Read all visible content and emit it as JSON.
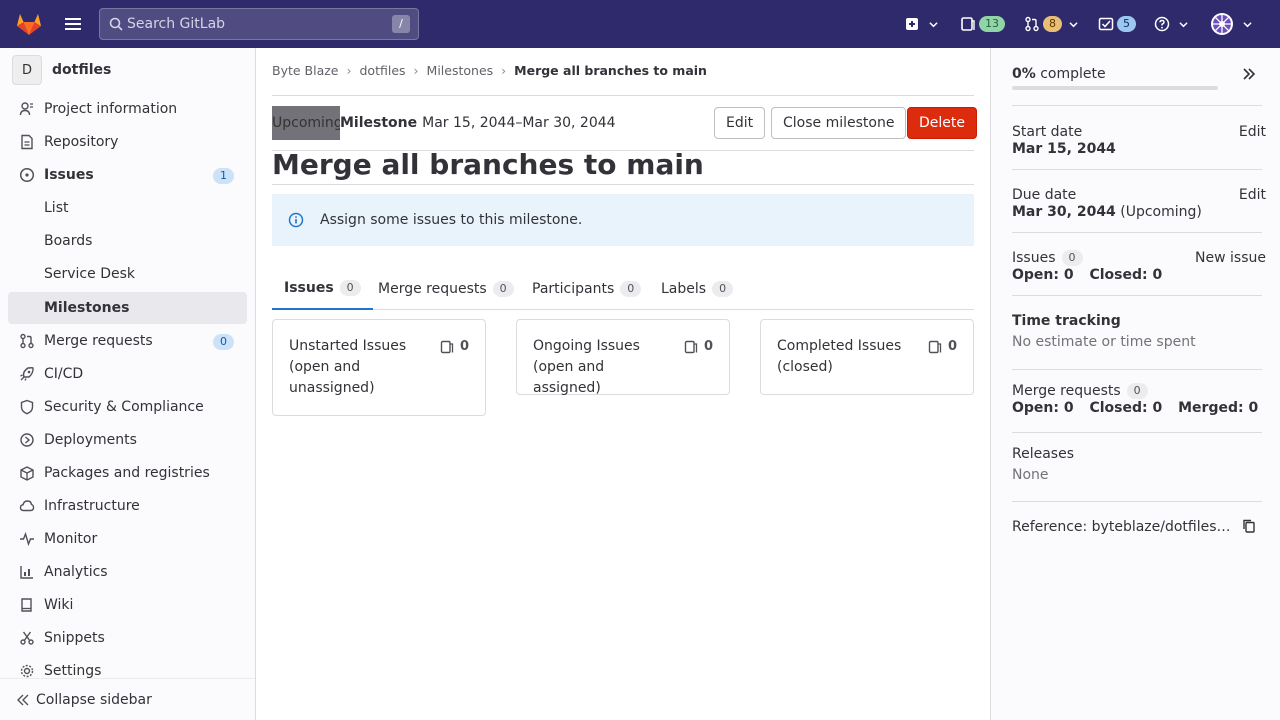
{
  "colors": {
    "topbar": "#2f2a6b",
    "danger": "#dd2b0e",
    "link_accent": "#1f75cb",
    "badge_blue": "#cbe2f9",
    "alert_bg": "#e9f3fc"
  },
  "topbar": {
    "logo_icon": "gitlab-tanuki-icon",
    "menu_icon": "hamburger-icon",
    "search_placeholder": "Search GitLab",
    "search_shortcut": "/",
    "issues_count": "13",
    "merge_requests_count": "8",
    "todos_count": "5"
  },
  "sidebar": {
    "project_initial": "D",
    "project_name": "dotfiles",
    "items": [
      {
        "label": "Project information",
        "icon": "info-icon"
      },
      {
        "label": "Repository",
        "icon": "doc-icon"
      },
      {
        "label": "Issues",
        "icon": "issues-icon",
        "count": "1"
      },
      {
        "label": "List"
      },
      {
        "label": "Boards"
      },
      {
        "label": "Service Desk"
      },
      {
        "label": "Milestones"
      },
      {
        "label": "Merge requests",
        "icon": "merge-request-icon",
        "count": "0"
      },
      {
        "label": "CI/CD",
        "icon": "rocket-icon"
      },
      {
        "label": "Security & Compliance",
        "icon": "shield-icon"
      },
      {
        "label": "Deployments",
        "icon": "deployments-icon"
      },
      {
        "label": "Packages and registries",
        "icon": "package-icon"
      },
      {
        "label": "Infrastructure",
        "icon": "cloud-icon"
      },
      {
        "label": "Monitor",
        "icon": "monitor-icon"
      },
      {
        "label": "Analytics",
        "icon": "chart-icon"
      },
      {
        "label": "Wiki",
        "icon": "book-icon"
      },
      {
        "label": "Snippets",
        "icon": "snippet-icon"
      },
      {
        "label": "Settings",
        "icon": "gear-icon"
      }
    ],
    "collapse_label": "Collapse sidebar"
  },
  "breadcrumb": [
    "Byte Blaze",
    "dotfiles",
    "Milestones",
    "Merge all branches to main"
  ],
  "milestone": {
    "status_badge": "Upcoming",
    "label": "Milestone",
    "dates": "Mar 15, 2044–Mar 30, 2044",
    "title": "Merge all branches to main",
    "edit_button": "Edit",
    "close_button": "Close milestone",
    "delete_button": "Delete",
    "alert_text": "Assign some issues to this milestone."
  },
  "tabs": [
    {
      "label": "Issues",
      "count": "0"
    },
    {
      "label": "Merge requests",
      "count": "0"
    },
    {
      "label": "Participants",
      "count": "0"
    },
    {
      "label": "Labels",
      "count": "0"
    }
  ],
  "boards": [
    {
      "title": "Unstarted Issues (open and unassigned)",
      "count": "0"
    },
    {
      "title": "Ongoing Issues (open and assigned)",
      "count": "0"
    },
    {
      "title": "Completed Issues (closed)",
      "count": "0"
    }
  ],
  "right_sidebar": {
    "percent": "0%",
    "complete_label": "complete",
    "progress_fraction": 0,
    "start_date_label": "Start date",
    "start_date": "Mar 15, 2044",
    "due_date_label": "Due date",
    "due_date": "Mar 30, 2044",
    "due_date_status": "(Upcoming)",
    "edit_label": "Edit",
    "issues_label": "Issues",
    "issues_count": "0",
    "new_issue": "New issue",
    "issues_open": "Open: 0",
    "issues_closed": "Closed: 0",
    "time_tracking_label": "Time tracking",
    "time_tracking_value": "No estimate or time spent",
    "mr_label": "Merge requests",
    "mr_count": "0",
    "mr_open": "Open: 0",
    "mr_closed": "Closed: 0",
    "mr_merged": "Merged: 0",
    "releases_label": "Releases",
    "releases_value": "None",
    "reference": "Reference: byteblaze/dotfiles%\"..."
  }
}
